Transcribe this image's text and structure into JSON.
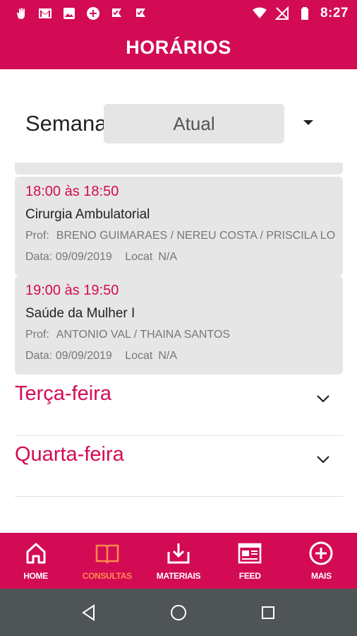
{
  "status_bar": {
    "time": "8:27",
    "left_icons": [
      "hand-icon",
      "gmail-icon",
      "image-icon",
      "plus-circle-icon",
      "check-flag-icon",
      "check-flag-icon"
    ],
    "right_icons": [
      "wifi-icon",
      "no-signal-icon",
      "battery-icon"
    ]
  },
  "app_bar": {
    "title": "HORÁRIOS"
  },
  "week": {
    "label": "Semana",
    "selected": "Atual"
  },
  "classes": [
    {
      "time": "18:00 às 18:50",
      "subject": "Cirurgia Ambulatorial",
      "prof_label": "Prof:",
      "prof": "BRENO GUIMARAES / NEREU COSTA / PRISCILA LOP...",
      "date_label": "Data:",
      "date": "09/09/2019",
      "location_label": "Locat",
      "location": "N/A"
    },
    {
      "time": "19:00 às 19:50",
      "subject": "Saúde da Mulher I",
      "prof_label": "Prof:",
      "prof": "ANTONIO VAL / THAINA SANTOS",
      "date_label": "Data:",
      "date": "09/09/2019",
      "location_label": "Locat",
      "location": "N/A"
    }
  ],
  "days": [
    "Terça-feira",
    "Quarta-feira"
  ],
  "bottom_nav": [
    {
      "label": "HOME",
      "icon": "home-icon",
      "active": false
    },
    {
      "label": "CONSULTAS",
      "icon": "book-icon",
      "active": true
    },
    {
      "label": "MATERIAIS",
      "icon": "download-icon",
      "active": false
    },
    {
      "label": "FEED",
      "icon": "newspaper-icon",
      "active": false
    },
    {
      "label": "MAIS",
      "icon": "plus-circle-icon",
      "active": false
    }
  ],
  "colors": {
    "primary": "#d30b55",
    "active_nav": "#ff8a4c",
    "card_bg": "#e6e6e6",
    "system_nav": "#4f5557"
  }
}
